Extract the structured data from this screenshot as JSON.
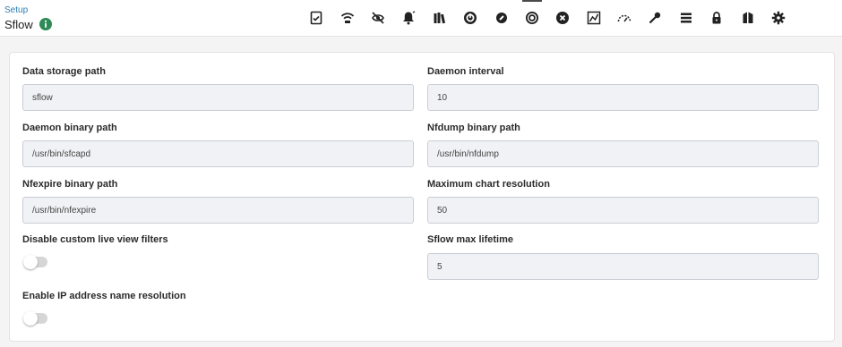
{
  "header": {
    "breadcrumb": "Setup",
    "title": "Sflow"
  },
  "toolbar": {
    "icons": [
      "checklist-icon",
      "wifi-icon",
      "eye-off-icon",
      "bell-icon",
      "books-icon",
      "power-icon",
      "wrench-icon",
      "target-icon",
      "close-circle-icon",
      "chart-icon",
      "gauge-icon",
      "key-icon",
      "list-icon",
      "lock-icon",
      "building-icon",
      "gear-icon"
    ],
    "active_index": 7
  },
  "form": {
    "left": {
      "data_storage_path": {
        "label": "Data storage path",
        "value": "sflow"
      },
      "daemon_binary_path": {
        "label": "Daemon binary path",
        "value": "/usr/bin/sfcapd"
      },
      "nfexpire_binary_path": {
        "label": "Nfexpire binary path",
        "value": "/usr/bin/nfexpire"
      },
      "disable_live_view_filters": {
        "label": "Disable custom live view filters",
        "enabled": false
      },
      "enable_ip_name_resolution": {
        "label": "Enable IP address name resolution",
        "enabled": false
      }
    },
    "right": {
      "daemon_interval": {
        "label": "Daemon interval",
        "value": "10"
      },
      "nfdump_binary_path": {
        "label": "Nfdump binary path",
        "value": "/usr/bin/nfdump"
      },
      "max_chart_resolution": {
        "label": "Maximum chart resolution",
        "value": "50"
      },
      "sflow_max_lifetime": {
        "label": "Sflow max lifetime",
        "value": "5"
      }
    }
  },
  "colors": {
    "accent": "#2d7db3",
    "info_badge": "#2e8b57",
    "input_bg": "#f1f2f5",
    "input_border": "#c9cdd6"
  }
}
